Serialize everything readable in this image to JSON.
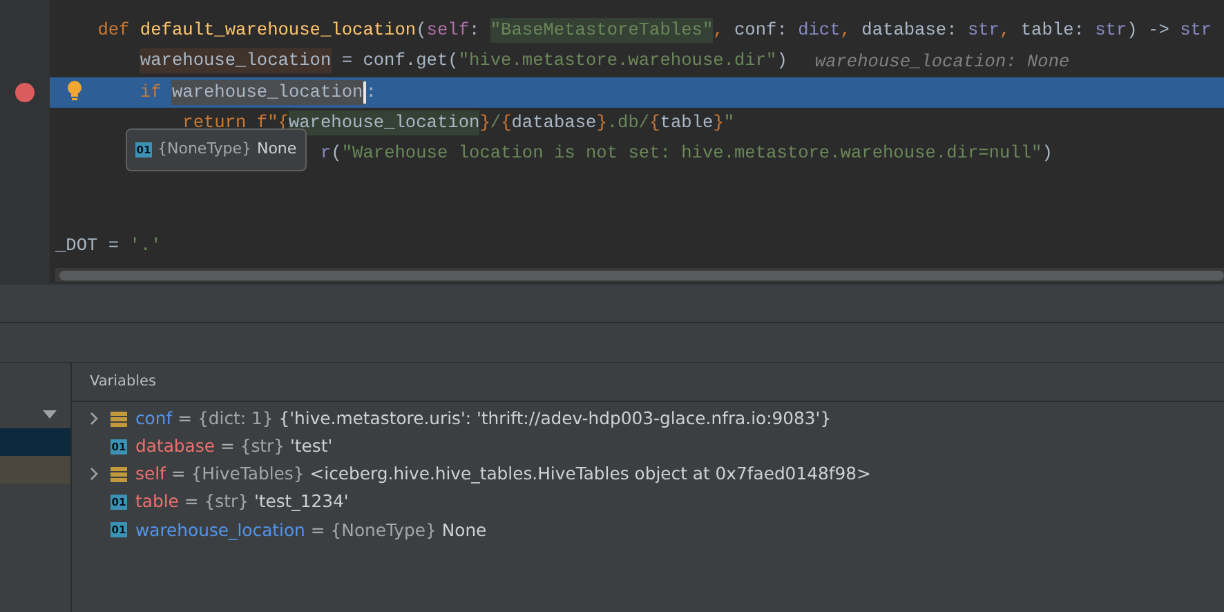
{
  "editor": {
    "lines": [
      {
        "kind": "blank"
      },
      {
        "kind": "method",
        "tokens": [
          {
            "text": "def ",
            "kind": "keyword"
          },
          {
            "text": "default_warehouse_location",
            "kind": "function"
          },
          {
            "text": "(",
            "kind": "plain"
          },
          {
            "text": "self",
            "kind": "self"
          },
          {
            "text": ": ",
            "kind": "plain"
          },
          {
            "text": "\"BaseMetastoreTables\"",
            "kind": "quotematch"
          },
          {
            "text": ", ",
            "kind": "keyword"
          },
          {
            "text": "conf: ",
            "kind": "plain"
          },
          {
            "text": "dict",
            "kind": "builtin"
          },
          {
            "text": ", ",
            "kind": "keyword"
          },
          {
            "text": "database: ",
            "kind": "plain"
          },
          {
            "text": "str",
            "kind": "builtin"
          },
          {
            "text": ", ",
            "kind": "keyword"
          },
          {
            "text": "table: ",
            "kind": "plain"
          },
          {
            "text": "str",
            "kind": "builtin"
          },
          {
            "text": ") -> ",
            "kind": "plain"
          },
          {
            "text": "str",
            "kind": "builtin"
          }
        ]
      },
      {
        "kind": "body",
        "tokens": [
          {
            "text": "warehouse_location",
            "kind": "assignment"
          },
          {
            "text": " = conf.get(",
            "kind": "plain"
          },
          {
            "text": "\"hive.metastore.warehouse.dir\"",
            "kind": "string"
          },
          {
            "text": ")",
            "kind": "plain"
          }
        ],
        "hint": "warehouse_location: None"
      },
      {
        "kind": "body",
        "tokens": [
          {
            "text": "if ",
            "kind": "keyword"
          },
          {
            "text": "warehouse_location",
            "kind": "usage",
            "caret": true
          },
          {
            "text": ":",
            "kind": "plain"
          }
        ],
        "current": true,
        "breakpoint": true,
        "intention": true
      },
      {
        "kind": "nested",
        "tokens": [
          {
            "text": "return f\"",
            "kind": "keyword"
          },
          {
            "text": "{",
            "kind": "keyword"
          },
          {
            "text": "warehouse_location",
            "kind": "match"
          },
          {
            "text": "}",
            "kind": "keyword"
          },
          {
            "text": "/",
            "kind": "string"
          },
          {
            "text": "{",
            "kind": "keyword"
          },
          {
            "text": "database",
            "kind": "plain"
          },
          {
            "text": "}",
            "kind": "keyword"
          },
          {
            "text": ".db/",
            "kind": "string"
          },
          {
            "text": "{",
            "kind": "keyword"
          },
          {
            "text": "table",
            "kind": "plain"
          },
          {
            "text": "}",
            "kind": "keyword"
          },
          {
            "text": "\"",
            "kind": "string"
          }
        ]
      },
      {
        "kind": "partial",
        "tokens": [
          {
            "text": "r",
            "kind": "builtin"
          },
          {
            "text": "(",
            "kind": "plain"
          },
          {
            "text": "\"Warehouse location is not set: hive.metastore.warehouse.dir=null\"",
            "kind": "string"
          },
          {
            "text": ")",
            "kind": "plain"
          }
        ]
      },
      {
        "kind": "blank"
      },
      {
        "kind": "blank"
      },
      {
        "kind": "toplevel",
        "tokens": [
          {
            "text": "_DOT = ",
            "kind": "plain"
          },
          {
            "text": "'.'",
            "kind": "string"
          }
        ]
      }
    ],
    "tooltip": {
      "badge": "01",
      "type": "{NoneType}",
      "value": "None"
    }
  },
  "frames": [
    {
      "kind": "selected"
    },
    {
      "kind": "library"
    }
  ],
  "variables": {
    "title": "Variables",
    "items": [
      {
        "expandable": true,
        "kind": "dict",
        "name": "conf",
        "color": "#5394ec",
        "equals": "=",
        "type": "{dict: 1}",
        "value": "{'hive.metastore.uris': 'thrift://adev-hdp003-glace.nfra.io:9083'}"
      },
      {
        "expandable": false,
        "kind": "value",
        "badge": "01",
        "name": "database",
        "color": "#ef6f6f",
        "equals": "=",
        "type": "{str}",
        "value": "'test'"
      },
      {
        "expandable": true,
        "kind": "dict",
        "name": "self",
        "color": "#ef6f6f",
        "equals": "=",
        "type": "{HiveTables}",
        "value": "<iceberg.hive.hive_tables.HiveTables object at 0x7faed0148f98>"
      },
      {
        "expandable": false,
        "kind": "value",
        "badge": "01",
        "name": "table",
        "color": "#ef6f6f",
        "equals": "=",
        "type": "{str}",
        "value": "'test_1234'"
      },
      {
        "expandable": false,
        "kind": "value",
        "badge": "01",
        "name": "warehouse_location",
        "color": "#5394ec",
        "equals": "=",
        "type": "{NoneType}",
        "value": "None"
      }
    ]
  }
}
